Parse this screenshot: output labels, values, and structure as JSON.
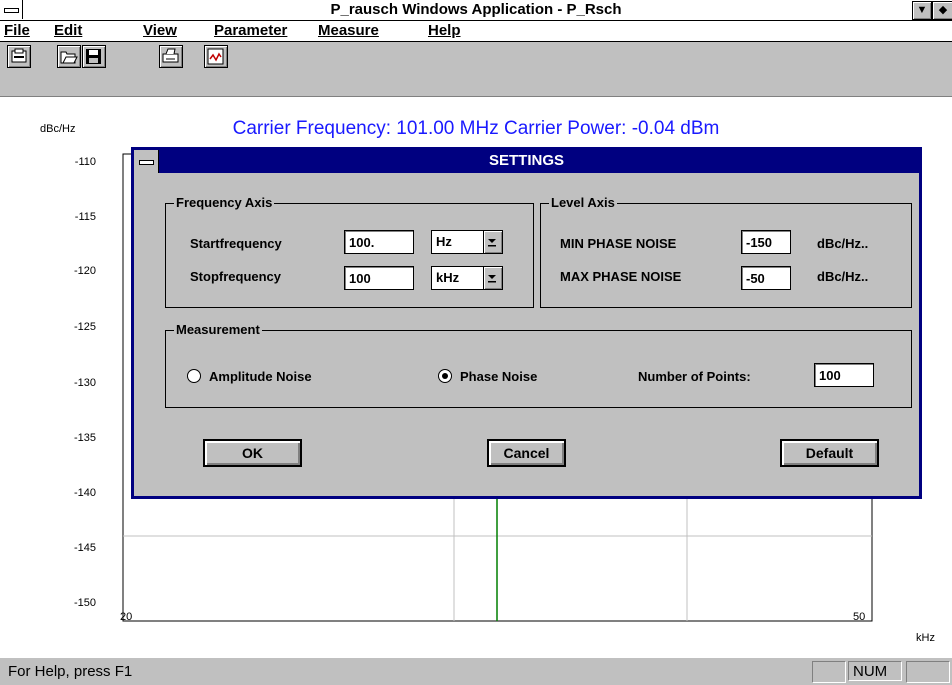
{
  "window": {
    "title": "P_rausch Windows Application - P_Rsch",
    "min_glyph": "▼",
    "max_glyph": "◆"
  },
  "menu": {
    "file": "File",
    "edit": "Edit",
    "view": "View",
    "parameter": "Parameter",
    "measure": "Measure",
    "help": "Help"
  },
  "toolbar": {
    "icons": [
      "printer-icon",
      "open-icon",
      "save-icon",
      "print-icon",
      "graph-icon"
    ]
  },
  "chart": {
    "carrier_text": "Carrier Frequency: 101.00 MHz   Carrier Power: -0.04 dBm",
    "ylabel": "dBc/Hz",
    "yticks": [
      "-110",
      "-115",
      "-120",
      "-125",
      "-130",
      "-135",
      "-140",
      "-145",
      "-150"
    ],
    "x_start": "20",
    "x_end": "50",
    "x_unit": "kHz",
    "colors": {
      "carrier_text": "#1a1aff",
      "marker": "#007f00",
      "grid": "#c0c0c0"
    }
  },
  "dialog": {
    "title": "SETTINGS",
    "frequency_axis": {
      "label": "Frequency Axis",
      "start_label": "Startfrequency",
      "start_value": "100.",
      "start_unit": "Hz",
      "stop_label": "Stopfrequency",
      "stop_value": "100",
      "stop_unit": "kHz"
    },
    "level_axis": {
      "label": "Level Axis",
      "min_label": "MIN PHASE NOISE",
      "min_value": "-150",
      "min_unit": "dBc/Hz..",
      "max_label": "MAX PHASE NOISE",
      "max_value": "-50",
      "max_unit": "dBc/Hz.."
    },
    "measurement": {
      "label": "Measurement",
      "amplitude_label": "Amplitude Noise",
      "phase_label": "Phase Noise",
      "selected": "Phase Noise",
      "points_label": "Number of Points:",
      "points_value": "100"
    },
    "buttons": {
      "ok": "OK",
      "cancel": "Cancel",
      "default": "Default"
    },
    "colors": {
      "title_bar": "#000080",
      "face": "#c0c0c0"
    }
  },
  "status": {
    "help_text": "For Help, press F1",
    "num": "NUM"
  }
}
